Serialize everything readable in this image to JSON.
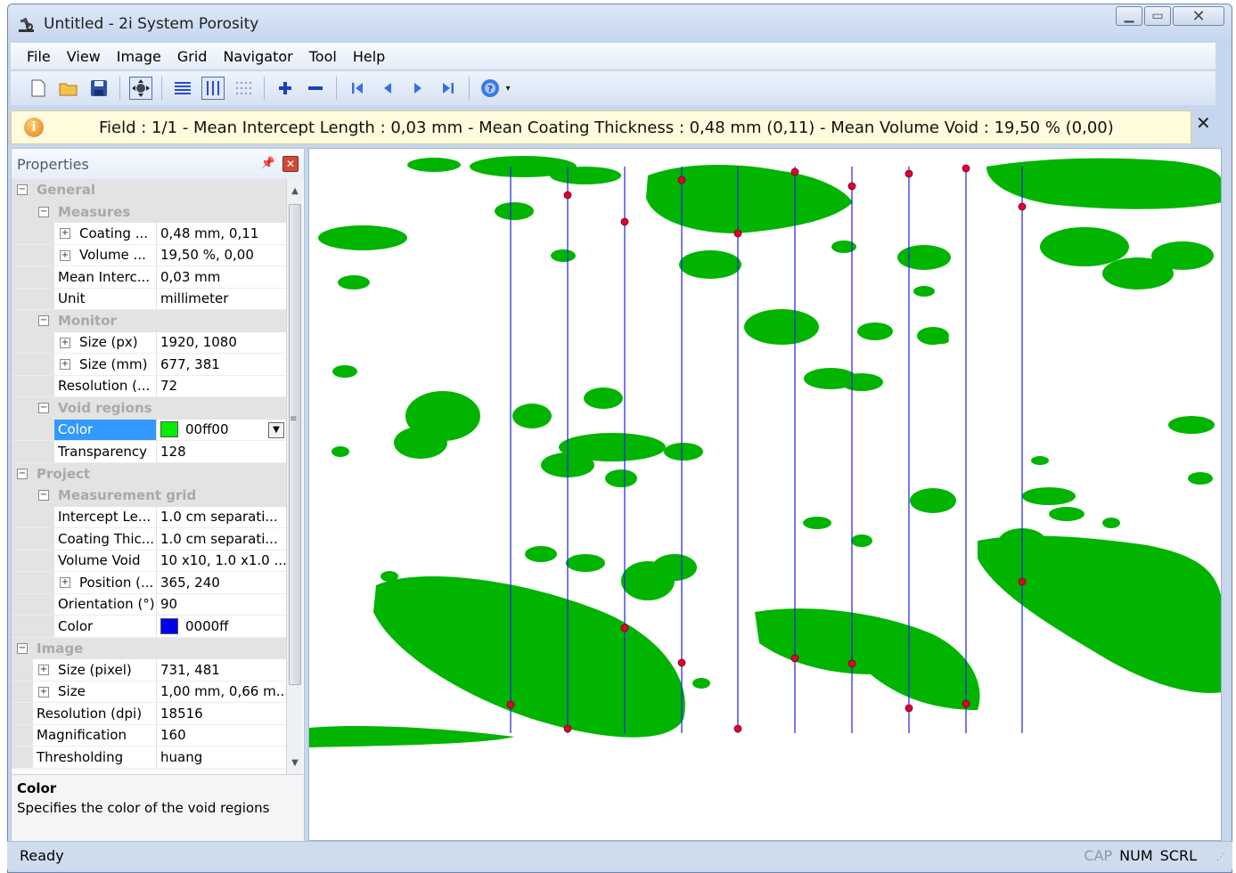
{
  "window": {
    "title": "Untitled - 2i System Porosity"
  },
  "menu": [
    "File",
    "View",
    "Image",
    "Grid",
    "Navigator",
    "Tool",
    "Help"
  ],
  "toolbar": {
    "buttons": [
      "new-file-icon",
      "open-folder-icon",
      "save-disk-icon",
      "pan-move-icon",
      "horizontal-lines-icon",
      "vertical-lines-icon",
      "dot-grid-icon",
      "zoom-in-plus-icon",
      "zoom-out-minus-icon",
      "first-field-icon",
      "previous-field-icon",
      "next-field-icon",
      "last-field-icon",
      "help-icon"
    ]
  },
  "info_bar": {
    "text": "Field : 1/1 - Mean Intercept Length : 0,03 mm - Mean Coating Thickness : 0,48 mm (0,11) - Mean Volume Void : 19,50 % (0,00)"
  },
  "properties": {
    "title": "Properties",
    "rows": [
      {
        "kind": "cat",
        "level": 0,
        "name": "General"
      },
      {
        "kind": "cat",
        "level": 1,
        "name": "Measures"
      },
      {
        "kind": "prop",
        "level": 2,
        "expand": true,
        "name": "Coating ...",
        "value": "0,48 mm, 0,11"
      },
      {
        "kind": "prop",
        "level": 2,
        "expand": true,
        "name": "Volume ...",
        "value": "19,50 %, 0,00"
      },
      {
        "kind": "prop",
        "level": 2,
        "name": "Mean Interc...",
        "value": "0,03 mm"
      },
      {
        "kind": "prop",
        "level": 2,
        "name": "Unit",
        "value": "millimeter"
      },
      {
        "kind": "cat",
        "level": 1,
        "name": "Monitor"
      },
      {
        "kind": "prop",
        "level": 2,
        "expand": true,
        "name": "Size (px)",
        "value": "1920, 1080"
      },
      {
        "kind": "prop",
        "level": 2,
        "expand": true,
        "name": "Size (mm)",
        "value": "677, 381"
      },
      {
        "kind": "prop",
        "level": 2,
        "name": "Resolution (...",
        "value": "72"
      },
      {
        "kind": "cat",
        "level": 1,
        "name": "Void regions"
      },
      {
        "kind": "prop",
        "level": 2,
        "name": "Color",
        "value": "00ff00",
        "swatch": "#00ee00",
        "selected": true,
        "dropdown": true
      },
      {
        "kind": "prop",
        "level": 2,
        "name": "Transparency",
        "value": "128"
      },
      {
        "kind": "cat",
        "level": 0,
        "name": "Project"
      },
      {
        "kind": "cat",
        "level": 1,
        "name": "Measurement grid"
      },
      {
        "kind": "prop",
        "level": 2,
        "name": "Intercept Le...",
        "value": "1.0 cm separati..."
      },
      {
        "kind": "prop",
        "level": 2,
        "name": "Coating Thic...",
        "value": "1.0 cm separati..."
      },
      {
        "kind": "prop",
        "level": 2,
        "name": "Volume Void",
        "value": "10 x10, 1.0 x1.0 ..."
      },
      {
        "kind": "prop",
        "level": 2,
        "expand": true,
        "name": "Position (...",
        "value": "365, 240"
      },
      {
        "kind": "prop",
        "level": 2,
        "name": "Orientation (°)",
        "value": "90"
      },
      {
        "kind": "prop",
        "level": 2,
        "name": "Color",
        "value": "0000ff",
        "swatch": "#0000ee"
      },
      {
        "kind": "cat",
        "level": 0,
        "name": "Image"
      },
      {
        "kind": "prop",
        "level": 1,
        "expand": true,
        "name": "Size (pixel)",
        "value": "731, 481"
      },
      {
        "kind": "prop",
        "level": 1,
        "expand": true,
        "name": "Size",
        "value": "1,00 mm, 0,66 m..."
      },
      {
        "kind": "prop",
        "level": 1,
        "name": "Resolution (dpi)",
        "value": "18516"
      },
      {
        "kind": "prop",
        "level": 1,
        "name": "Magnification",
        "value": "160"
      },
      {
        "kind": "prop",
        "level": 1,
        "name": "Thresholding",
        "value": "huang"
      }
    ],
    "description": {
      "title": "Color",
      "text": "Specifies the color of the void regions"
    }
  },
  "viewer": {
    "void_color": "#00b400",
    "grid_color": "#2020e0",
    "point_color": "#e00030",
    "orientation_deg": 90
  },
  "status": {
    "text": "Ready",
    "indicators": [
      {
        "label": "CAP",
        "active": false
      },
      {
        "label": "NUM",
        "active": true
      },
      {
        "label": "SCRL",
        "active": true
      }
    ]
  }
}
